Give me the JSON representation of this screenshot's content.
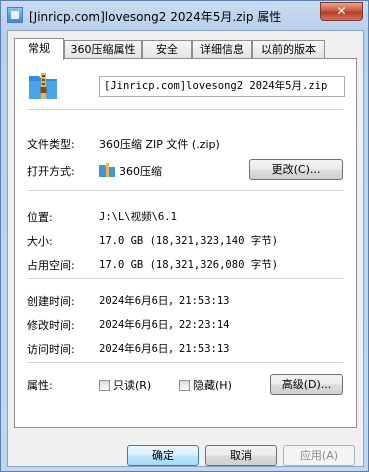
{
  "window": {
    "title": "[Jinricp.com]lovesong2 2024年5月.zip 属性",
    "close_label": "✕"
  },
  "tabs": [
    {
      "label": "常规",
      "active": true
    },
    {
      "label": "360压缩属性",
      "active": false
    },
    {
      "label": "安全",
      "active": false
    },
    {
      "label": "详细信息",
      "active": false
    },
    {
      "label": "以前的版本",
      "active": false
    }
  ],
  "file": {
    "name": "[Jinricp.com]lovesong2 2024年5月.zip",
    "type_label": "文件类型:",
    "type_value": "360压缩 ZIP 文件 (.zip)",
    "open_with_label": "打开方式:",
    "open_with_value": "360压缩",
    "change_button": "更改(C)...",
    "location_label": "位置:",
    "location_value": "J:\\L\\视频\\6.1",
    "size_label": "大小:",
    "size_value": "17.0 GB (18,321,323,140 字节)",
    "size_on_disk_label": "占用空间:",
    "size_on_disk_value": "17.0 GB (18,321,326,080 字节)",
    "created_label": "创建时间:",
    "created_value": "2024年6月6日，21:53:13",
    "modified_label": "修改时间:",
    "modified_value": "2024年6月6日，22:23:14",
    "accessed_label": "访问时间:",
    "accessed_value": "2024年6月6日，21:53:13",
    "attributes_label": "属性:",
    "readonly_label": "只读(R)",
    "hidden_label": "隐藏(H)",
    "advanced_button": "高级(D)..."
  },
  "footer": {
    "ok": "确定",
    "cancel": "取消",
    "apply": "应用(A)"
  },
  "colors": {
    "accent": "#3c7fb1",
    "close": "#c7513a"
  }
}
